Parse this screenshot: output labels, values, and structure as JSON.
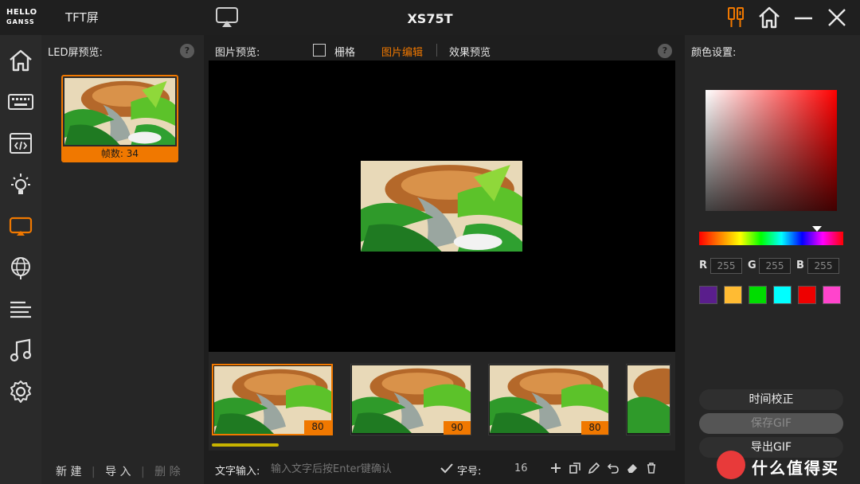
{
  "app": {
    "logo_line1": "HELLO",
    "logo_line2": "GANSS",
    "section_title": "TFT屏",
    "window_title": "XS75T"
  },
  "colors": {
    "accent": "#f07800",
    "progress": "#c8b400",
    "background": "#1e1e1e"
  },
  "titlebar_icons": [
    "screen-cast-icon",
    "settings-sliders-icon",
    "home-icon",
    "minimize-icon",
    "close-icon"
  ],
  "rail": {
    "icons": [
      "home-icon",
      "keyboard-icon",
      "code-window-icon",
      "light-bulb-icon",
      "screen-icon",
      "globe-icon",
      "text-lines-icon",
      "music-note-icon",
      "gear-icon"
    ],
    "active_index": 4
  },
  "led_panel": {
    "title": "LED屏预览:",
    "help": "?",
    "thumbnail_caption": "帧数: 34",
    "actions": {
      "new": "新 建",
      "import": "导 入",
      "delete": "删 除"
    }
  },
  "preview": {
    "title": "图片预览:",
    "grid_label": "栅格",
    "grid_checked": false,
    "tab_edit": "图片编辑",
    "tab_effect": "效果预览",
    "active_tab": "图片编辑",
    "help": "?"
  },
  "frames": [
    {
      "number": "80",
      "selected": true
    },
    {
      "number": "90",
      "selected": false
    },
    {
      "number": "80",
      "selected": false
    }
  ],
  "text_input": {
    "label": "文字输入:",
    "placeholder": "输入文字后按Enter键确认",
    "size_label": "字号:",
    "size_value": "16",
    "tool_icons": [
      "check-icon",
      "plus-icon",
      "copy-icon",
      "pen-icon",
      "undo-icon",
      "eraser-icon",
      "trash-icon"
    ]
  },
  "color_panel": {
    "title": "颜色设置:",
    "r_label": "R",
    "g_label": "G",
    "b_label": "B",
    "r_value": "255",
    "g_value": "255",
    "b_value": "255",
    "swatches": [
      "#5a1e8c",
      "#ffbb33",
      "#00dd00",
      "#00ffff",
      "#ee0000",
      "#ff44cc"
    ],
    "buttons": {
      "time_sync": "时间校正",
      "save_gif": "保存GIF",
      "export_gif": "导出GIF"
    }
  },
  "watermark": {
    "text": "什么值得买"
  }
}
